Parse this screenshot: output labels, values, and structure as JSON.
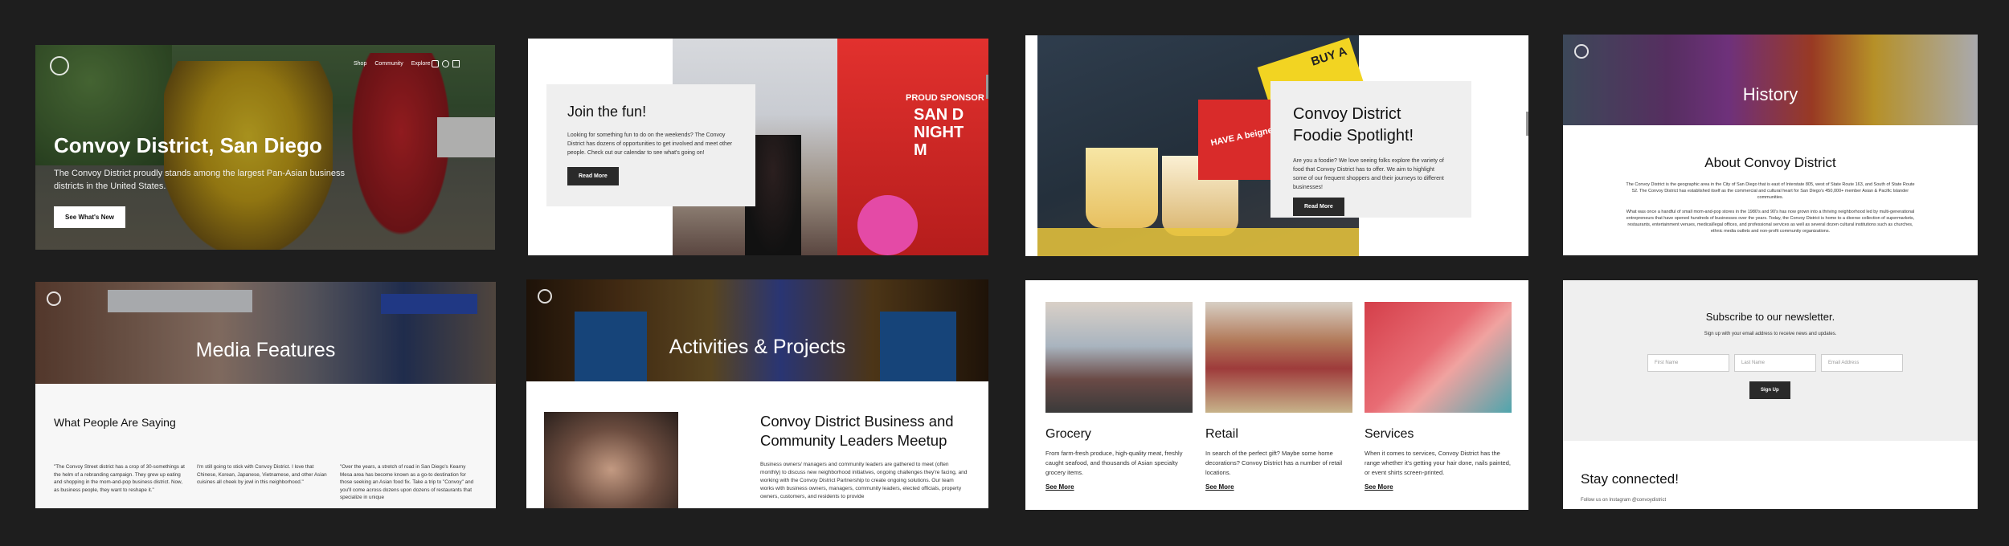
{
  "colors": {
    "page_bg": "#1e1e1e",
    "button_dark": "#2a2a2a",
    "panel_gray": "#efefef"
  },
  "p1": {
    "nav": [
      "Shop",
      "Community",
      "Explore"
    ],
    "title": "Convoy District, San Diego",
    "subtitle": "The Convoy District proudly stands among the largest Pan-Asian business districts in the United States.",
    "button": "See What's New"
  },
  "p2": {
    "heading": "Join the fun!",
    "body": "Looking for something fun to do on the weekends? The Convoy District has dozens of opportunities to get involved and meet other people. Check out our calendar to see what's going on!",
    "button": "Read More",
    "sign_top": "PROUD SPONSOR",
    "sign_main": "SAN D NIGHT M"
  },
  "p3": {
    "heading_line1": "Convoy District",
    "heading_line2": "Foodie Spotlight!",
    "body": "Are you a foodie? We love seeing folks explore the variety of food that Convoy District has to offer. We aim to highlight some of our frequent shoppers and their journeys to different businesses!",
    "button": "Read More",
    "sign": "BUY A",
    "cup_label": "HAVE A beignet"
  },
  "p4": {
    "banner_title": "History",
    "heading": "About Convoy District",
    "para1": "The Convoy District is the geographic area in the City of San Diego that is east of Interstate 805, west of State Route 163, and South of State Route 52. The Convoy District has established itself as the commercial and cultural heart for San Diego's 450,000+ member Asian & Pacific Islander communities.",
    "para2": "What was once a handful of small mom-and-pop stores in the 1980's and 90's has now grown into a thriving neighborhood led by multi-generational entrepreneurs that have opened hundreds of businesses over the years. Today, the Convoy District is home to a diverse collection of supermarkets, restaurants, entertainment venues, medical/legal offices, and professional services as well as several dozen cultural institutions such as churches, ethnic media outlets and non-profit community organizations."
  },
  "p5": {
    "banner_title": "Media Features",
    "heading": "What People Are Saying",
    "quote1": "\"The Convoy Street district has a crop of 30-somethings at the helm of a rebranding campaign. They grew up eating and shopping in the mom-and-pop business district. Now, as business people, they want to reshape it.\"",
    "quote2": "I'm still going to stick with Convoy District. I love that Chinese, Korean, Japanese, Vietnamese, and other Asian cuisines all cheek by jowl in this neighborhood.\"",
    "quote3": "\"Over the years, a stretch of road in San Diego's Kearny Mesa area has become known as a go-to destination for those seeking an Asian food fix. Take a trip to \"Convoy\" and you'll come across dozens upon dozens of restaurants that specialize in unique"
  },
  "p6": {
    "banner_title": "Activities & Projects",
    "heading_line1": "Convoy District Business and",
    "heading_line2": "Community Leaders Meetup",
    "body": "Business owners/ managers and community leaders are gathered to meet (often monthly) to discuss new neighborhood initiatives, ongoing challenges they're facing, and working with the Convoy District Partnership to create ongoing solutions. Our team works with business owners, managers, community leaders, elected officials, property owners, customers, and residents to provide"
  },
  "p7": {
    "cards": [
      {
        "title": "Grocery",
        "body": "From farm-fresh produce, high-quality meat, freshly caught seafood, and thousands of Asian specialty grocery items.",
        "link": "See More"
      },
      {
        "title": "Retail",
        "body": "In search of the perfect gift? Maybe some home decorations? Convoy District has a number of retail locations.",
        "link": "See More"
      },
      {
        "title": "Services",
        "body": "When it comes to services, Convoy District has the range whether it's getting your hair done, nails painted, or event shirts screen-printed.",
        "link": "See More"
      }
    ]
  },
  "p8": {
    "heading": "Subscribe to our newsletter.",
    "sub": "Sign up with your email address to receive news and updates.",
    "placeholders": {
      "first": "First Name",
      "last": "Last Name",
      "email": "Email Address"
    },
    "button": "Sign Up",
    "connected": "Stay connected!",
    "follow": "Follow us on Instagram @convoydistrict"
  }
}
